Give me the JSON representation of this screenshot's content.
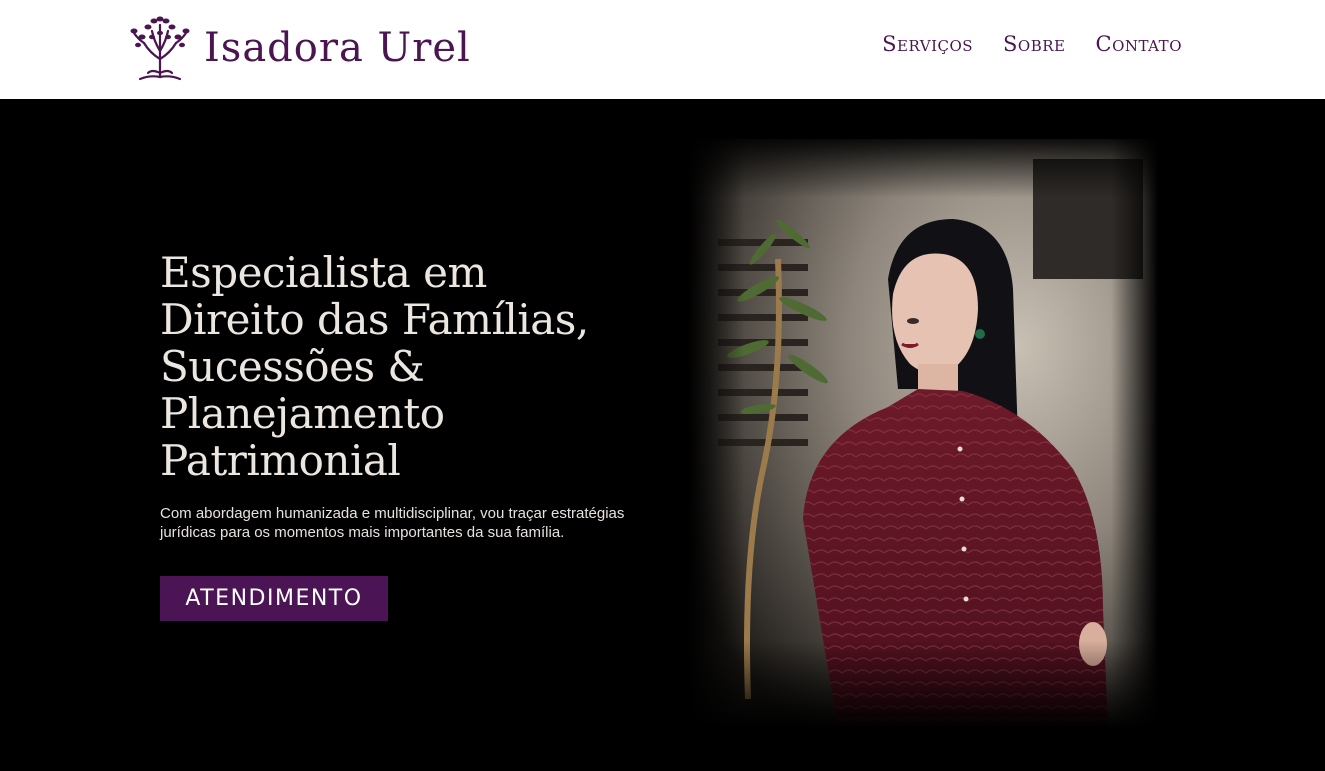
{
  "brand": {
    "name": "Isadora Urel",
    "logo_icon": "tree-icon",
    "color": "#4a1550"
  },
  "nav": {
    "items": [
      {
        "label": "Serviços"
      },
      {
        "label": "Sobre"
      },
      {
        "label": "Contato"
      }
    ]
  },
  "hero": {
    "title": "Especialista em Direito das Famílias, Sucessões & Planejamento Patrimonial",
    "subtitle": "Com abordagem humanizada e multidisciplinar, vou traçar estratégias jurídicas para os momentos mais importantes da sua família.",
    "cta_label": "ATENDIMENTO",
    "cta_color": "#4b1454"
  },
  "photo": {
    "description_icon": "portrait-photo"
  }
}
